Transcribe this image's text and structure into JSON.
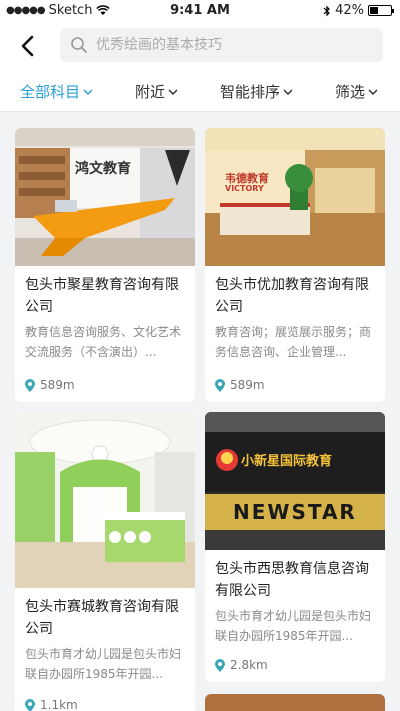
{
  "status_bar": {
    "carrier": "Sketch",
    "time": "9:41 AM",
    "battery": "42%",
    "battery_level": 0.42
  },
  "header": {
    "search_placeholder": "优秀绘画的基本技巧"
  },
  "filters": [
    {
      "label": "全部科目",
      "active": true
    },
    {
      "label": "附近",
      "active": false
    },
    {
      "label": "智能排序",
      "active": false
    },
    {
      "label": "筛选",
      "active": false
    }
  ],
  "cards": [
    {
      "title": "包头市聚星教育咨询有限公司",
      "description": "教育信息咨询服务、文化艺术交流服务（不含演出）...",
      "distance": "589m",
      "sign_text": "鸿文教育"
    },
    {
      "title": "包头市优加教育咨询有限公司",
      "description": "教育咨询；展览展示服务；商务信息咨询、企业管理...",
      "distance": "589m",
      "sign_text": "韦德教育",
      "sign_subtext": "VICTORY"
    },
    {
      "title": "包头市赛城教育咨询有限公司",
      "description": "包头市育才幼儿园是包头市妇联自办园所1985年开园...",
      "distance": "1.1km"
    },
    {
      "title": "包头市西思教育信息咨询有限公司",
      "description": "包头市育才幼儿园是包头市妇联自办园所1985年开园...",
      "distance": "2.8km",
      "sign_text": "小新星国际教育",
      "sign_subtext": "NEWSTAR"
    }
  ],
  "colors": {
    "accent": "#2a9fd6",
    "pin": "#3aa8b8"
  }
}
